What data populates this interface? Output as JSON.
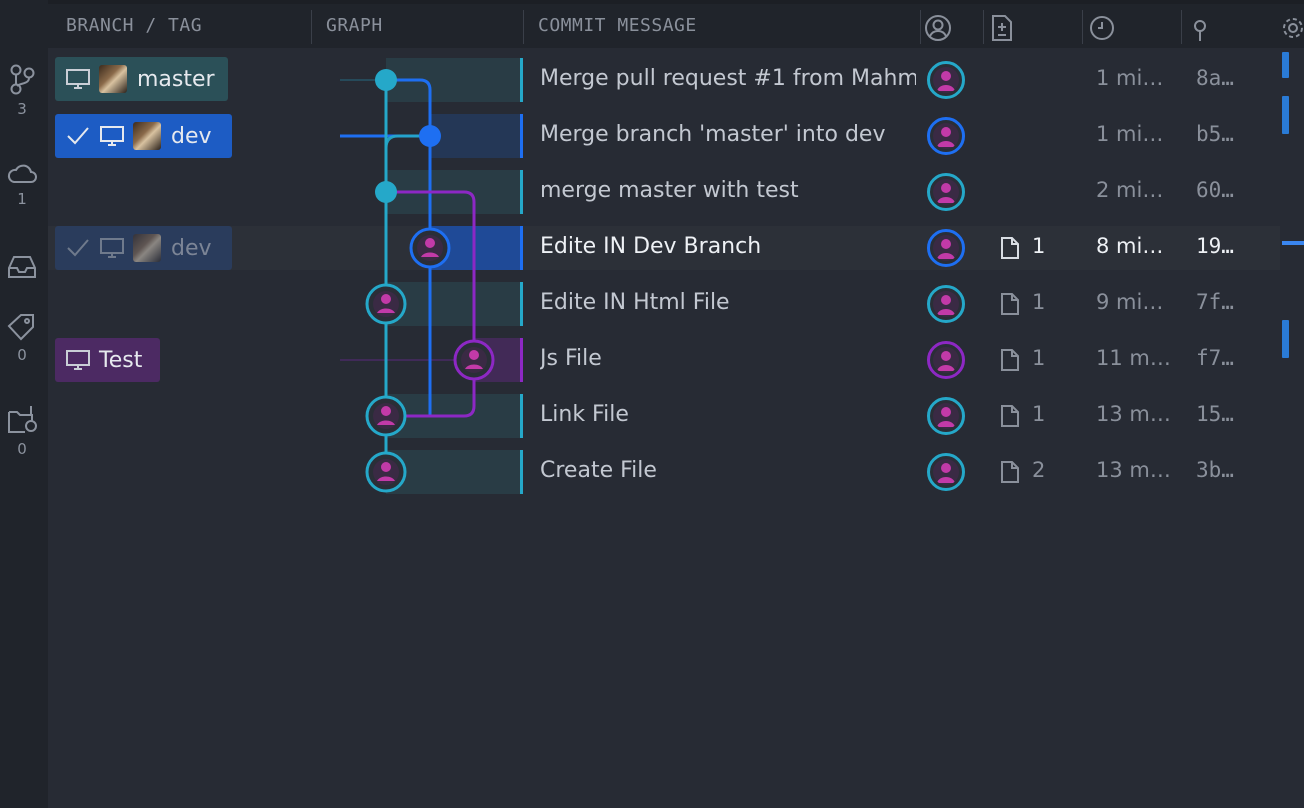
{
  "colors": {
    "cyan": "#25a8c9",
    "blue": "#1e6ff2",
    "purple": "#8d28c4",
    "selected_row": "#264a85",
    "master_label": "#2b5058",
    "dev_label": "#1d5cc4",
    "test_label": "#4c2a63"
  },
  "activity": {
    "branches_count": "3",
    "remotes_count": "1",
    "tags_count": "0",
    "worktrees_count": "0"
  },
  "header": {
    "branch_tag": "BRANCH / TAG",
    "graph": "GRAPH",
    "commit_message": "COMMIT MESSAGE"
  },
  "labels": {
    "master": "master",
    "dev": "dev",
    "dev_local": "dev",
    "test": "Test"
  },
  "commits": [
    {
      "message": "Merge pull request #1 from Mahm",
      "files": "",
      "date": "1 mi…",
      "sha": "8a…",
      "lane": "cyan"
    },
    {
      "message": "Merge branch 'master' into dev",
      "files": "",
      "date": "1 mi…",
      "sha": "b5…",
      "lane": "blue"
    },
    {
      "message": "merge master with test",
      "files": "",
      "date": "2 mi…",
      "sha": "60…",
      "lane": "cyan"
    },
    {
      "message": "Edite IN Dev Branch",
      "files": "1",
      "date": "8 mi…",
      "sha": "19…",
      "lane": "blue",
      "selected": true
    },
    {
      "message": "Edite IN Html File",
      "files": "1",
      "date": "9 mi…",
      "sha": "7f…",
      "lane": "cyan"
    },
    {
      "message": "Js File",
      "files": "1",
      "date": "11 m…",
      "sha": "f7…",
      "lane": "purple"
    },
    {
      "message": "Link File",
      "files": "1",
      "date": "13 m…",
      "sha": "15…",
      "lane": "cyan"
    },
    {
      "message": "Create File",
      "files": "2",
      "date": "13 m…",
      "sha": "3b…",
      "lane": "cyan"
    }
  ],
  "icons": [
    "branch-icon",
    "cloud-icon",
    "inbox-icon",
    "tag-icon",
    "worktree-icon",
    "author-icon",
    "file-changes-icon",
    "clock-icon",
    "commit-icon",
    "gear-icon",
    "monitor-icon",
    "check-icon",
    "file-icon"
  ]
}
